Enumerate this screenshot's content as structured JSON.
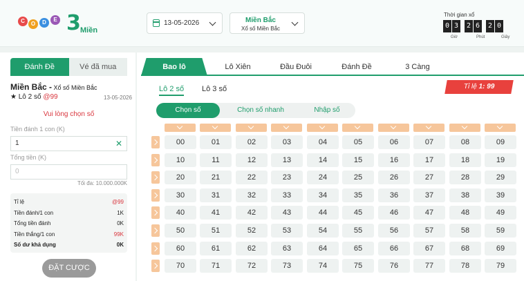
{
  "header": {
    "logo_balls": [
      "C",
      "O",
      "D",
      "E"
    ],
    "logo_number": "3",
    "logo_text": "Miền",
    "date": "13-05-2026",
    "region_name": "Miền Bắc",
    "region_sub": "Xổ số Miền Bắc",
    "timer_label": "Thời gian xổ",
    "timer_digits": [
      "0",
      "3",
      "2",
      "6",
      "2",
      "0"
    ],
    "timer_units": [
      "Giờ",
      "Phút",
      "Giây"
    ]
  },
  "left": {
    "tabs": [
      "Đánh Đề",
      "Vé đã mua"
    ],
    "region_title": "Miền Bắc -",
    "region_sub": " Xổ số Miền Bắc",
    "game_prefix": "★ Lô 2 số ",
    "game_odds": "@99",
    "game_date": "13-05-2026",
    "warning": "Vui lòng chọn số",
    "per_label": "Tiền đánh 1 con (K)",
    "per_value": "1",
    "total_label": "Tổng tiền (K)",
    "total_placeholder": "0",
    "max_note": "Tối đa: 10.000.000K",
    "summary": [
      {
        "label": "Tỉ lệ",
        "value": "@99"
      },
      {
        "label": "Tiền đánh/1 con",
        "value": "1K"
      },
      {
        "label": "Tổng tiền đánh",
        "value": "0K"
      },
      {
        "label": "Tiền thắng/1 con",
        "value": "99K"
      },
      {
        "label": "Số dư khả dụng",
        "value": "0K"
      }
    ],
    "bet_button": "ĐẶT CƯỢC"
  },
  "right": {
    "tabs": [
      "Bao lô",
      "Lô Xiên",
      "Đầu Đuôi",
      "Đánh Đề",
      "3 Càng"
    ],
    "subtabs": [
      "Lô 2 số",
      "Lô 3 số"
    ],
    "ratio_label": "Tỉ lệ ",
    "ratio_value": "1: 99",
    "modes": [
      "Chọn số",
      "Chọn số nhanh",
      "Nhập số"
    ],
    "rows": [
      [
        "00",
        "01",
        "02",
        "03",
        "04",
        "05",
        "06",
        "07",
        "08",
        "09"
      ],
      [
        "10",
        "11",
        "12",
        "13",
        "14",
        "15",
        "16",
        "17",
        "18",
        "19"
      ],
      [
        "20",
        "21",
        "22",
        "23",
        "24",
        "25",
        "26",
        "27",
        "28",
        "29"
      ],
      [
        "30",
        "31",
        "32",
        "33",
        "34",
        "35",
        "36",
        "37",
        "38",
        "39"
      ],
      [
        "40",
        "41",
        "42",
        "43",
        "44",
        "45",
        "46",
        "47",
        "48",
        "49"
      ],
      [
        "50",
        "51",
        "52",
        "53",
        "54",
        "55",
        "56",
        "57",
        "58",
        "59"
      ],
      [
        "60",
        "61",
        "62",
        "63",
        "64",
        "65",
        "66",
        "67",
        "68",
        "69"
      ],
      [
        "70",
        "71",
        "72",
        "73",
        "74",
        "75",
        "76",
        "77",
        "78",
        "79"
      ]
    ]
  }
}
